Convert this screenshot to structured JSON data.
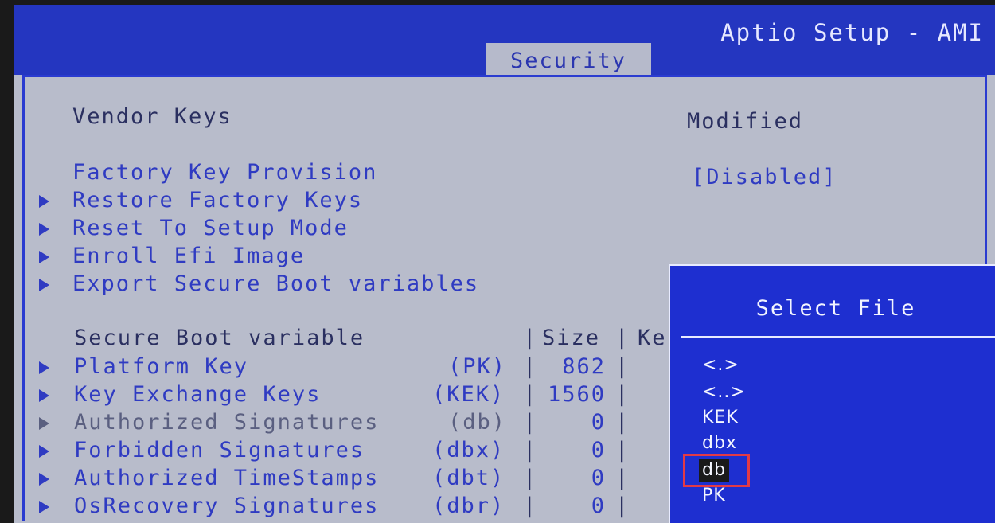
{
  "header": {
    "app_title": "Aptio Setup - AMI",
    "active_tab": "Security"
  },
  "settings": {
    "vendor_keys": {
      "label": "Vendor Keys",
      "value": "Modified"
    },
    "factory_key_provision": {
      "label": "Factory Key Provision",
      "value": "[Disabled]"
    },
    "submenus": [
      {
        "label": "Restore Factory Keys"
      },
      {
        "label": "Reset To Setup Mode"
      },
      {
        "label": "Enroll Efi Image"
      },
      {
        "label": "Export Secure Boot variables"
      }
    ]
  },
  "variables_table": {
    "headers": {
      "name": "Secure Boot variable",
      "size": "Size",
      "keys": "Ke"
    },
    "rows": [
      {
        "name": "Platform Key",
        "code": "(PK)",
        "size": "862"
      },
      {
        "name": "Key Exchange Keys",
        "code": "(KEK)",
        "size": "1560"
      },
      {
        "name": "Authorized Signatures",
        "code": "(db)",
        "size": "0"
      },
      {
        "name": "Forbidden Signatures",
        "code": "(dbx)",
        "size": "0"
      },
      {
        "name": "Authorized TimeStamps",
        "code": "(dbt)",
        "size": "0"
      },
      {
        "name": "OsRecovery Signatures",
        "code": "(dbr)",
        "size": "0"
      }
    ]
  },
  "select_file_dialog": {
    "title": "Select File",
    "items": [
      "<.>",
      "<..>",
      "KEK",
      "dbx",
      "db",
      "PK"
    ],
    "selected": "db"
  }
}
